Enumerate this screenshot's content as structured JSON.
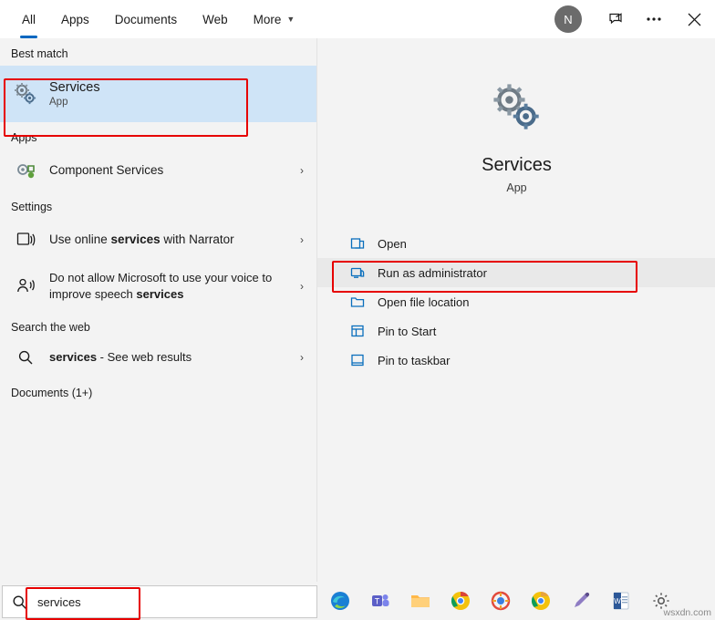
{
  "topnav": {
    "items": [
      {
        "label": "All",
        "active": true,
        "caret": false
      },
      {
        "label": "Apps",
        "active": false,
        "caret": false
      },
      {
        "label": "Documents",
        "active": false,
        "caret": false
      },
      {
        "label": "Web",
        "active": false,
        "caret": false
      },
      {
        "label": "More",
        "active": false,
        "caret": true
      }
    ],
    "avatar_initial": "N",
    "feedback_icon": "feedback-icon",
    "more_icon": "ellipsis-icon",
    "close_icon": "close-icon"
  },
  "left": {
    "best_match_header": "Best match",
    "best_match": {
      "title": "Services",
      "subtitle": "App",
      "icon": "services-gears-icon"
    },
    "apps_header": "Apps",
    "apps": [
      {
        "title": "Component Services",
        "icon": "component-services-icon",
        "chevron": "›"
      }
    ],
    "settings_header": "Settings",
    "settings": [
      {
        "title_parts": [
          "Use online ",
          "services",
          " with Narrator"
        ],
        "icon": "narrator-icon",
        "chevron": "›"
      },
      {
        "title_parts": [
          "Do not allow Microsoft to use your voice to improve speech ",
          "services",
          ""
        ],
        "icon": "speech-icon",
        "chevron": "›"
      }
    ],
    "web_header": "Search the web",
    "web": [
      {
        "bold": "services",
        "rest": " - See web results",
        "icon": "search-small-icon",
        "chevron": "›"
      }
    ],
    "documents_header": "Documents (1+)"
  },
  "right": {
    "app_icon": "services-gears-icon",
    "title": "Services",
    "subtitle": "App",
    "actions": [
      {
        "label": "Open",
        "icon": "open-icon",
        "highlight": false
      },
      {
        "label": "Run as administrator",
        "icon": "shield-run-icon",
        "highlight": true
      },
      {
        "label": "Open file location",
        "icon": "folder-icon",
        "highlight": false
      },
      {
        "label": "Pin to Start",
        "icon": "pin-start-icon",
        "highlight": false
      },
      {
        "label": "Pin to taskbar",
        "icon": "pin-taskbar-icon",
        "highlight": false
      }
    ]
  },
  "taskbar": {
    "search_icon": "search-icon",
    "search_value": "services",
    "search_placeholder": "Type here to search",
    "icons": [
      {
        "name": "edge-icon"
      },
      {
        "name": "teams-icon"
      },
      {
        "name": "file-explorer-icon"
      },
      {
        "name": "chrome-icon"
      },
      {
        "name": "unknown-colorful-icon"
      },
      {
        "name": "chrome-canary-icon"
      },
      {
        "name": "snip-sketch-icon"
      },
      {
        "name": "word-icon"
      },
      {
        "name": "settings-gear-icon"
      }
    ],
    "watermark": "wsxdn.com"
  },
  "colors": {
    "accent": "#0067c0",
    "selection": "#cfe4f7",
    "annotation": "#e60000",
    "panel": "#f3f3f3"
  }
}
